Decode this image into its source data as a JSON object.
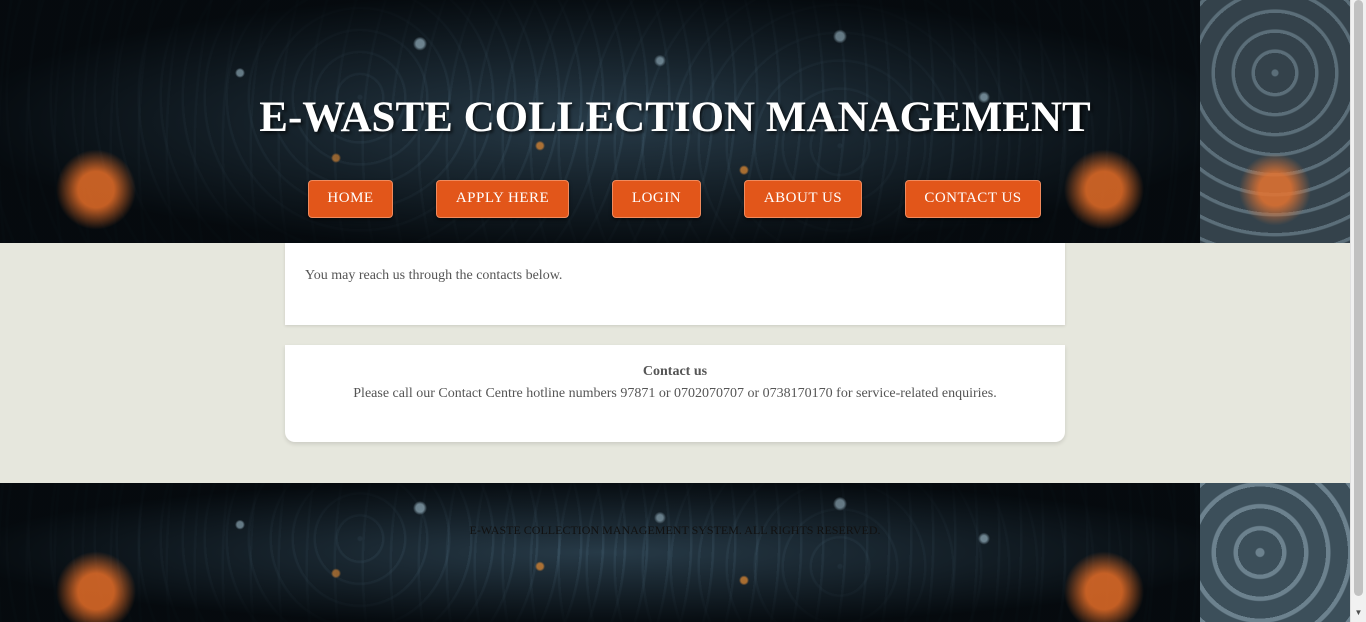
{
  "header": {
    "title": "E-WASTE COLLECTION MANAGEMENT"
  },
  "nav": {
    "home": "HOME",
    "apply": "APPLY HERE",
    "login": "LOGIN",
    "about": "ABOUT US",
    "contact": "CONTACT US"
  },
  "intro": {
    "text": "You may reach us through the contacts below."
  },
  "contact": {
    "heading": "Contact us",
    "text": "Please call our Contact Centre hotline numbers 97871 or 0702070707 or 0738170170 for service-related enquiries."
  },
  "footer": {
    "text": "E-WASTE COLLECTION MANAGEMENT SYSTEM. ALL RIGHTS RESERVED."
  },
  "colors": {
    "accent": "#e2561a",
    "content_bg": "#e6e7dd",
    "text": "#555555"
  },
  "icons": {
    "scroll_down": "chevron-down-icon"
  }
}
